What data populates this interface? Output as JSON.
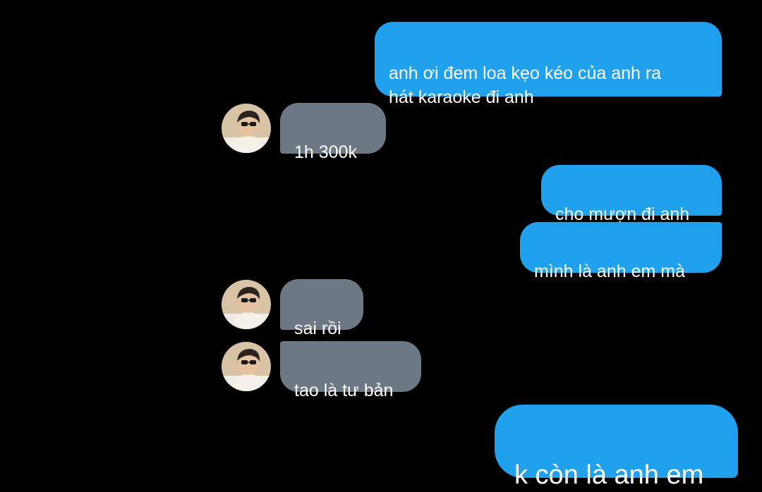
{
  "theme": {
    "background": "#000000",
    "sent_bubble": "#1fa1ee",
    "received_bubble": "#6c7884",
    "text": "#ffffff"
  },
  "messages": [
    {
      "direction": "sent",
      "text": "anh ơi đem loa kẹo kéo của anh ra\nhát karaoke đi anh"
    },
    {
      "direction": "received",
      "text": "1h 300k",
      "avatar": "contact-avatar"
    },
    {
      "direction": "sent",
      "text": "cho mượn đi anh"
    },
    {
      "direction": "sent",
      "text": "mình là anh em mà"
    },
    {
      "direction": "received",
      "text": "sai rồi",
      "avatar": "contact-avatar"
    },
    {
      "direction": "received",
      "text": "tao là tư bản",
      "avatar": "contact-avatar"
    },
    {
      "direction": "sent",
      "text": "k còn là anh em",
      "style": "large"
    }
  ]
}
